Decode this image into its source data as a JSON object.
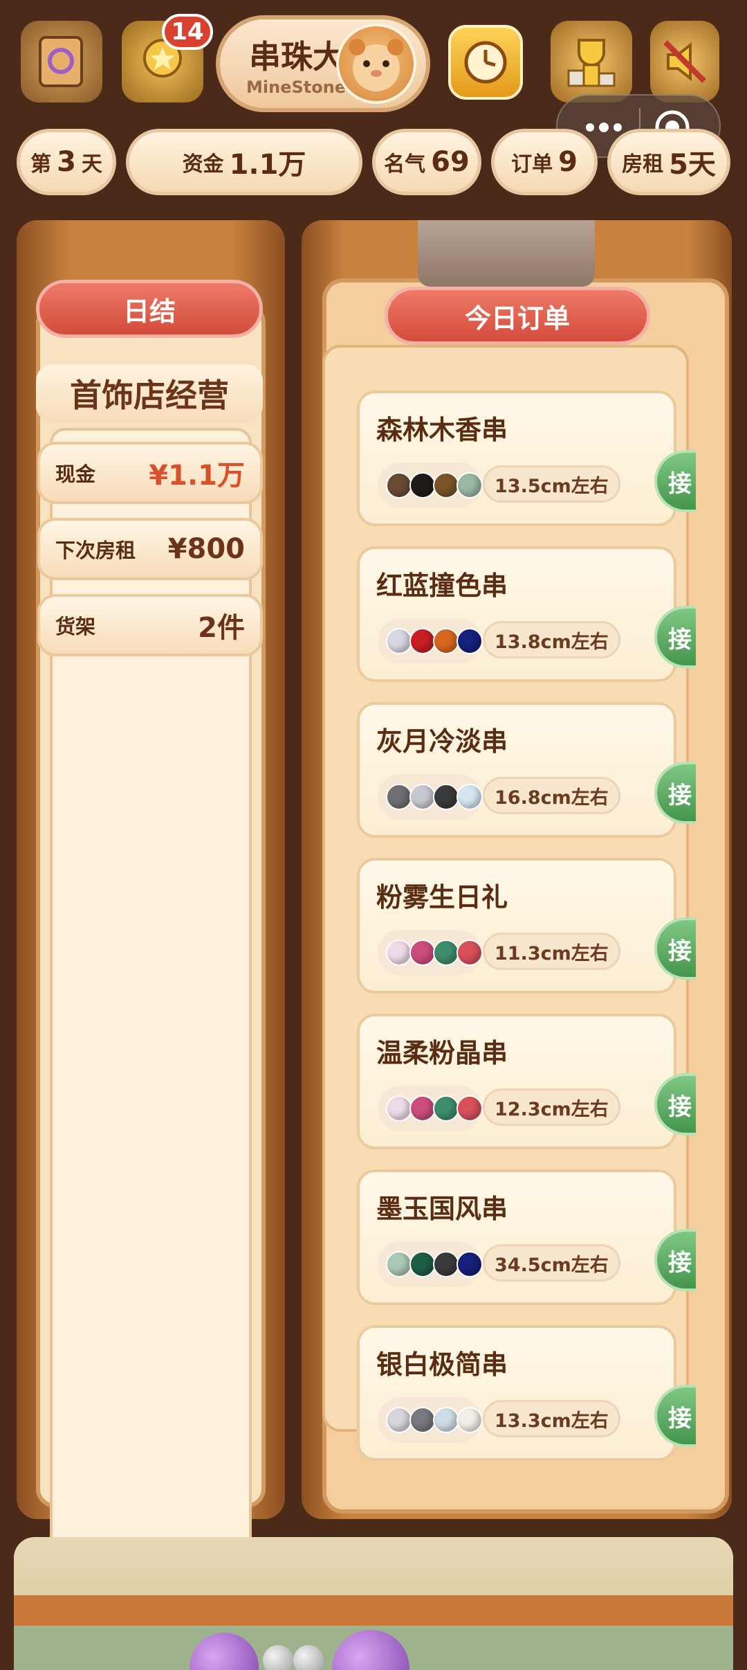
{
  "header": {
    "title": "串珠大",
    "subtitle": "MineStone",
    "badge_count": "14"
  },
  "stats": {
    "day_prefix": "第",
    "day_value": "3",
    "day_suffix": "天",
    "funds_label": "资金",
    "funds_value": "1.1万",
    "fame_label": "名气",
    "fame_value": "69",
    "orders_label": "订单",
    "orders_value": "9",
    "rent_label": "房租",
    "rent_value": "5天"
  },
  "left_panel": {
    "header": "日结",
    "subtitle": "首饰店经营",
    "rows": [
      {
        "label": "现金",
        "value": "¥1.1万"
      },
      {
        "label": "下次房租",
        "value": "¥800"
      },
      {
        "label": "货架",
        "value": "2件"
      }
    ]
  },
  "right_panel": {
    "header": "今日订单",
    "accept_label": "接",
    "orders": [
      {
        "name": "森林木香串",
        "length": "13.5cm左右",
        "beads": [
          "#6b4a33",
          "#1f1b19",
          "#7a5528",
          "#9bb8a4"
        ]
      },
      {
        "name": "红蓝撞色串",
        "length": "13.8cm左右",
        "beads": [
          "#d9d8e2",
          "#c81e24",
          "#d9661f",
          "#15217a"
        ]
      },
      {
        "name": "灰月冷淡串",
        "length": "16.8cm左右",
        "beads": [
          "#6f6e72",
          "#c8c8d0",
          "#3a3a3c",
          "#d6e6f0"
        ]
      },
      {
        "name": "粉雾生日礼",
        "length": "11.3cm左右",
        "beads": [
          "#efdbe8",
          "#cb4d7c",
          "#3e8d6c",
          "#d9505a"
        ]
      },
      {
        "name": "温柔粉晶串",
        "length": "12.3cm左右",
        "beads": [
          "#efdbe8",
          "#cb4d7c",
          "#3e8d6c",
          "#d9505a"
        ]
      },
      {
        "name": "墨玉国风串",
        "length": "34.5cm左右",
        "beads": [
          "#a9c9b4",
          "#1c5e45",
          "#3a3a3c",
          "#15217a"
        ]
      },
      {
        "name": "银白极简串",
        "length": "13.3cm左右",
        "beads": [
          "#d6d6dc",
          "#77797e",
          "#cfdde8",
          "#f2efe8"
        ]
      }
    ]
  }
}
